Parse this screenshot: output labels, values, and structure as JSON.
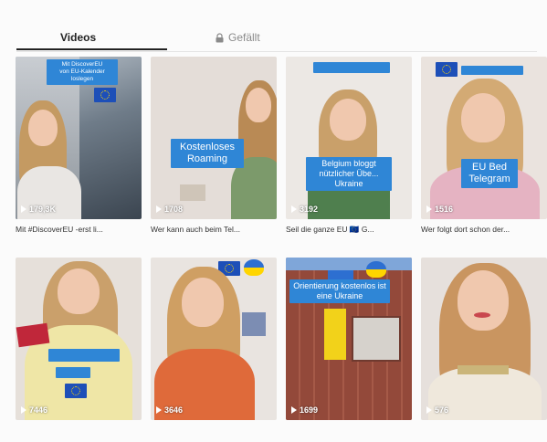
{
  "tabs": {
    "videos": "Videos",
    "liked": "Gefällt"
  },
  "colors": {
    "accent_blue": "#2f86d6",
    "eu_blue": "#1d4fb8",
    "ua_yellow": "#ffd500"
  },
  "videos": [
    {
      "views": "179,3K",
      "caption": "Mit #DiscoverEU -erst li...",
      "overlay": ""
    },
    {
      "views": "1708",
      "caption": "Wer kann auch beim Tel...",
      "overlay": "Kostenloses Roaming"
    },
    {
      "views": "3192",
      "caption": "Seil die ganze EU 🇪🇺 G...",
      "overlay": "Belgium bloggt nützlicher Übe... Ukraine"
    },
    {
      "views": "1516",
      "caption": "Wer folgt dort schon der...",
      "overlay": "EU Bed Telegram"
    },
    {
      "views": "7446",
      "caption": "",
      "overlay": ""
    },
    {
      "views": "3646",
      "caption": "",
      "overlay": ""
    },
    {
      "views": "1699",
      "caption": "",
      "overlay": "Orientierung kostenlos ist eine Ukraine"
    },
    {
      "views": "576",
      "caption": "",
      "overlay": ""
    }
  ]
}
